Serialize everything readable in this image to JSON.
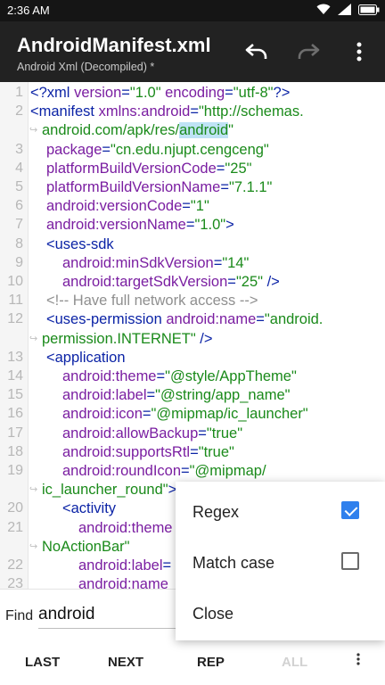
{
  "status": {
    "time": "2:36",
    "ampm": "AM"
  },
  "appbar": {
    "title": "AndroidManifest.xml",
    "subtitle": "Android Xml (Decompiled) *"
  },
  "code_lines": [
    {
      "num": "1",
      "wrap": false,
      "tokens": [
        {
          "c": "t-tag",
          "t": "<?xml "
        },
        {
          "c": "t-attr",
          "t": "version"
        },
        {
          "c": "t-pun",
          "t": "="
        },
        {
          "c": "t-val",
          "t": "\"1.0\""
        },
        {
          "c": "t-pun",
          "t": " "
        },
        {
          "c": "t-attr",
          "t": "encoding"
        },
        {
          "c": "t-pun",
          "t": "="
        },
        {
          "c": "t-val",
          "t": "\"utf-8\""
        },
        {
          "c": "t-tag",
          "t": "?>"
        }
      ]
    },
    {
      "num": "2",
      "wrap": false,
      "tokens": [
        {
          "c": "t-tag",
          "t": "<manifest "
        },
        {
          "c": "t-attr",
          "t": "xmlns:android"
        },
        {
          "c": "t-pun",
          "t": "="
        },
        {
          "c": "t-val",
          "t": "\"http://schemas."
        }
      ]
    },
    {
      "num": "",
      "wrap": true,
      "tokens": [
        {
          "c": "t-val",
          "t": "android.com/apk/res/"
        },
        {
          "c": "t-val hl",
          "t": "android"
        },
        {
          "c": "t-val",
          "t": "\""
        }
      ]
    },
    {
      "num": "3",
      "wrap": false,
      "indent": 1,
      "tokens": [
        {
          "c": "t-attr",
          "t": "package"
        },
        {
          "c": "t-pun",
          "t": "="
        },
        {
          "c": "t-val",
          "t": "\"cn.edu.njupt.cengceng\""
        }
      ]
    },
    {
      "num": "4",
      "wrap": false,
      "indent": 1,
      "tokens": [
        {
          "c": "t-attr",
          "t": "platformBuildVersionCode"
        },
        {
          "c": "t-pun",
          "t": "="
        },
        {
          "c": "t-val",
          "t": "\"25\""
        }
      ]
    },
    {
      "num": "5",
      "wrap": false,
      "indent": 1,
      "tokens": [
        {
          "c": "t-attr",
          "t": "platformBuildVersionName"
        },
        {
          "c": "t-pun",
          "t": "="
        },
        {
          "c": "t-val",
          "t": "\"7.1.1\""
        }
      ]
    },
    {
      "num": "6",
      "wrap": false,
      "indent": 1,
      "tokens": [
        {
          "c": "t-attr",
          "t": "android:versionCode"
        },
        {
          "c": "t-pun",
          "t": "="
        },
        {
          "c": "t-val",
          "t": "\"1\""
        }
      ]
    },
    {
      "num": "7",
      "wrap": false,
      "indent": 1,
      "tokens": [
        {
          "c": "t-attr",
          "t": "android:versionName"
        },
        {
          "c": "t-pun",
          "t": "="
        },
        {
          "c": "t-val",
          "t": "\"1.0\""
        },
        {
          "c": "t-tag",
          "t": ">"
        }
      ]
    },
    {
      "num": "8",
      "wrap": false,
      "indent": 1,
      "tokens": [
        {
          "c": "t-tag",
          "t": "<uses-sdk"
        }
      ]
    },
    {
      "num": "9",
      "wrap": false,
      "indent": 2,
      "tokens": [
        {
          "c": "t-attr",
          "t": "android:minSdkVersion"
        },
        {
          "c": "t-pun",
          "t": "="
        },
        {
          "c": "t-val",
          "t": "\"14\""
        }
      ]
    },
    {
      "num": "10",
      "wrap": false,
      "indent": 2,
      "tokens": [
        {
          "c": "t-attr",
          "t": "android:targetSdkVersion"
        },
        {
          "c": "t-pun",
          "t": "="
        },
        {
          "c": "t-val",
          "t": "\"25\""
        },
        {
          "c": "t-tag",
          "t": " />"
        }
      ]
    },
    {
      "num": "11",
      "wrap": false,
      "indent": 1,
      "tokens": [
        {
          "c": "t-com",
          "t": "<!-- Have full network access -->"
        }
      ]
    },
    {
      "num": "12",
      "wrap": false,
      "indent": 1,
      "tokens": [
        {
          "c": "t-tag",
          "t": "<uses-permission "
        },
        {
          "c": "t-attr",
          "t": "android:name"
        },
        {
          "c": "t-pun",
          "t": "="
        },
        {
          "c": "t-val",
          "t": "\"android."
        }
      ]
    },
    {
      "num": "",
      "wrap": true,
      "tokens": [
        {
          "c": "t-val",
          "t": "permission.INTERNET\""
        },
        {
          "c": "t-tag",
          "t": " />"
        }
      ]
    },
    {
      "num": "13",
      "wrap": false,
      "indent": 1,
      "tokens": [
        {
          "c": "t-tag",
          "t": "<application"
        }
      ]
    },
    {
      "num": "14",
      "wrap": false,
      "indent": 2,
      "tokens": [
        {
          "c": "t-attr",
          "t": "android:theme"
        },
        {
          "c": "t-pun",
          "t": "="
        },
        {
          "c": "t-val",
          "t": "\"@style/AppTheme\""
        }
      ]
    },
    {
      "num": "15",
      "wrap": false,
      "indent": 2,
      "tokens": [
        {
          "c": "t-attr",
          "t": "android:label"
        },
        {
          "c": "t-pun",
          "t": "="
        },
        {
          "c": "t-val",
          "t": "\"@string/app_name\""
        }
      ]
    },
    {
      "num": "16",
      "wrap": false,
      "indent": 2,
      "tokens": [
        {
          "c": "t-attr",
          "t": "android:icon"
        },
        {
          "c": "t-pun",
          "t": "="
        },
        {
          "c": "t-val",
          "t": "\"@mipmap/ic_launcher\""
        }
      ]
    },
    {
      "num": "17",
      "wrap": false,
      "indent": 2,
      "tokens": [
        {
          "c": "t-attr",
          "t": "android:allowBackup"
        },
        {
          "c": "t-pun",
          "t": "="
        },
        {
          "c": "t-val",
          "t": "\"true\""
        }
      ]
    },
    {
      "num": "18",
      "wrap": false,
      "indent": 2,
      "tokens": [
        {
          "c": "t-attr",
          "t": "android:supportsRtl"
        },
        {
          "c": "t-pun",
          "t": "="
        },
        {
          "c": "t-val",
          "t": "\"true\""
        }
      ]
    },
    {
      "num": "19",
      "wrap": false,
      "indent": 2,
      "tokens": [
        {
          "c": "t-attr",
          "t": "android:roundIcon"
        },
        {
          "c": "t-pun",
          "t": "="
        },
        {
          "c": "t-val",
          "t": "\"@mipmap/"
        }
      ]
    },
    {
      "num": "",
      "wrap": true,
      "tokens": [
        {
          "c": "t-val",
          "t": "ic_launcher_round\""
        },
        {
          "c": "t-tag",
          "t": ">"
        }
      ]
    },
    {
      "num": "20",
      "wrap": false,
      "indent": 2,
      "tokens": [
        {
          "c": "t-tag",
          "t": "<activity"
        }
      ]
    },
    {
      "num": "21",
      "wrap": false,
      "indent": 3,
      "tokens": [
        {
          "c": "t-attr",
          "t": "android:theme"
        }
      ]
    },
    {
      "num": "",
      "wrap": true,
      "tokens": [
        {
          "c": "t-val",
          "t": "NoActionBar\""
        }
      ]
    },
    {
      "num": "22",
      "wrap": false,
      "indent": 3,
      "tokens": [
        {
          "c": "t-attr",
          "t": "android:label"
        },
        {
          "c": "t-pun",
          "t": "="
        }
      ]
    },
    {
      "num": "23",
      "wrap": false,
      "indent": 3,
      "tokens": [
        {
          "c": "t-attr",
          "t": "android:name"
        }
      ]
    }
  ],
  "find": {
    "label": "Find",
    "value": "android"
  },
  "bottom": {
    "last": "LAST",
    "next": "NEXT",
    "replace": "REP",
    "all": "ALL"
  },
  "menu": {
    "regex_label": "Regex",
    "regex_checked": true,
    "matchcase_label": "Match case",
    "matchcase_checked": false,
    "close_label": "Close"
  },
  "colors": {
    "accent": "#2f80ed",
    "appbar": "#222222",
    "tag": "#0b23a6",
    "attr": "#7a1ea1",
    "value": "#1a8a1a",
    "comment": "#8f8f8f"
  },
  "icons": {
    "undo": "undo-icon",
    "redo": "redo-icon",
    "more": "more-vert-icon",
    "wifi": "wifi-icon",
    "signal": "signal-icon",
    "battery": "battery-icon"
  }
}
